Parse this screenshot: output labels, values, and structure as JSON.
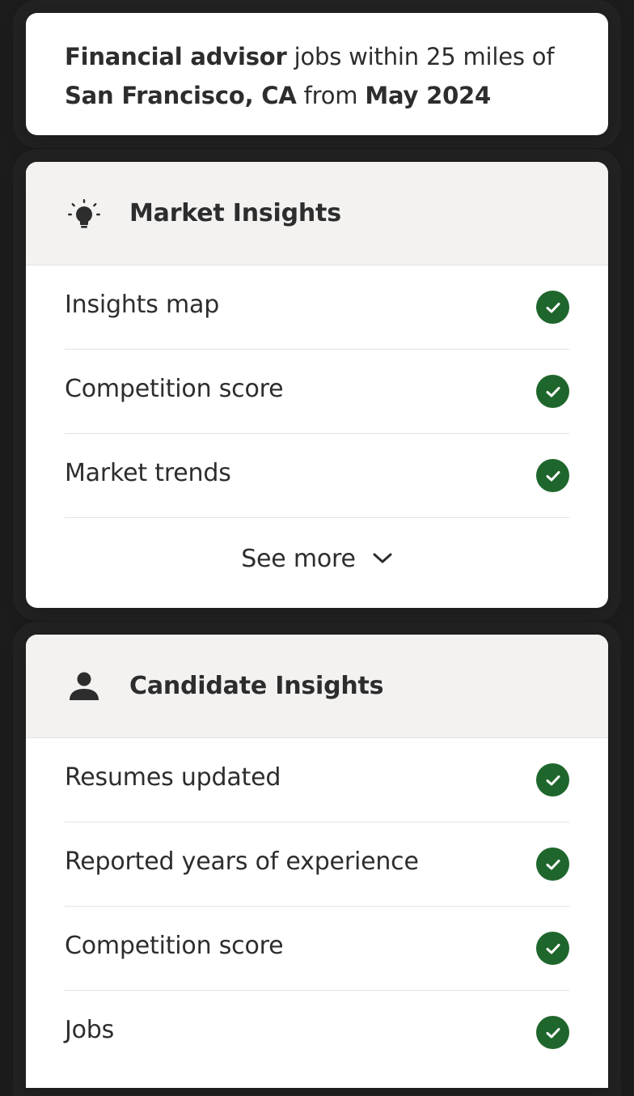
{
  "query": {
    "role": "Financial advisor",
    "mid1": " jobs within 25 miles of ",
    "location": "San Francisco, CA",
    "mid2": " from ",
    "date": "May 2024"
  },
  "market": {
    "title": "Market Insights",
    "icon": "lightbulb-icon",
    "items": [
      {
        "label": "Insights map"
      },
      {
        "label": "Competition score"
      },
      {
        "label": "Market trends"
      }
    ],
    "see_more": "See more"
  },
  "candidate": {
    "title": "Candidate Insights",
    "icon": "person-icon",
    "items": [
      {
        "label": "Resumes updated"
      },
      {
        "label": "Reported years of experience"
      },
      {
        "label": "Competition score"
      },
      {
        "label": "Jobs"
      }
    ]
  },
  "colors": {
    "check": "#1f662c",
    "header_bg": "#f3f2f1",
    "text": "#2d2d2d"
  }
}
